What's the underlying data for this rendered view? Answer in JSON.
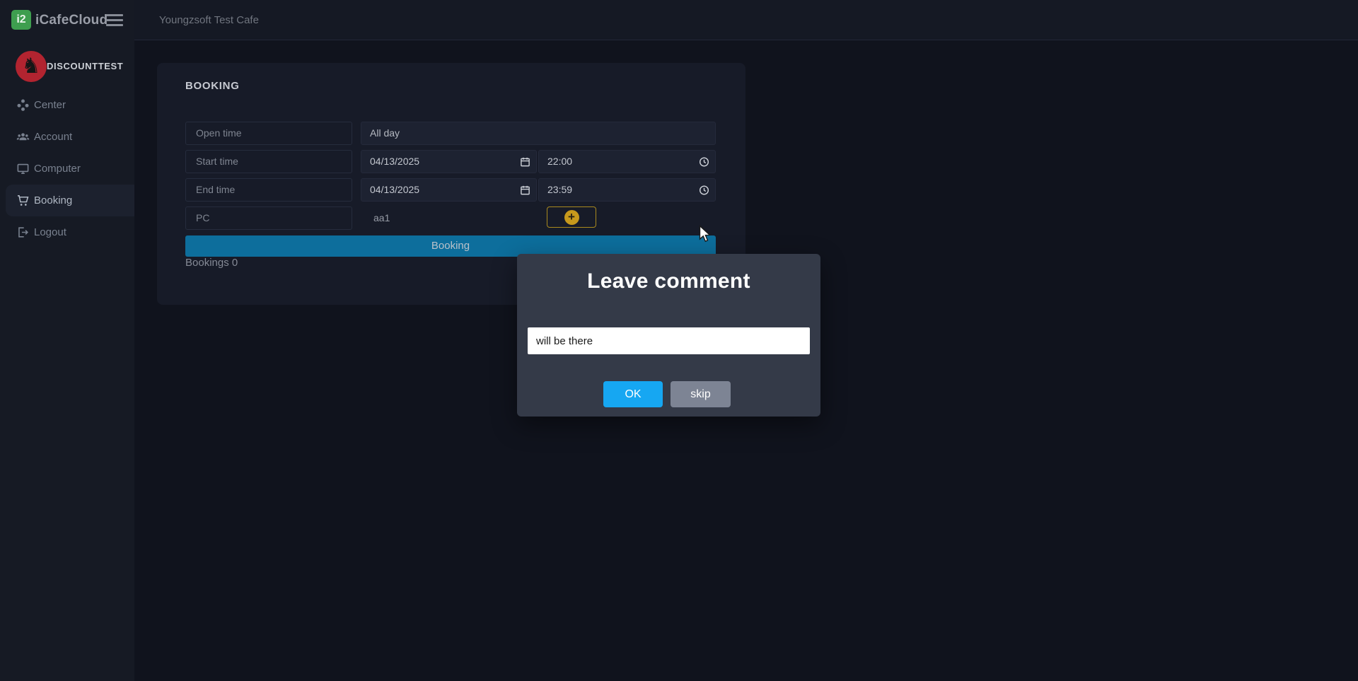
{
  "app": {
    "brand": "iCafeCloud",
    "logo_badge": "i2"
  },
  "topbar": {
    "cafe_name": "Youngzsoft Test Cafe"
  },
  "sidebar": {
    "user": {
      "name": "DISCOUNTTEST",
      "avatar_glyph": "♞"
    },
    "items": [
      {
        "label": "Center",
        "icon": "center-icon",
        "active": false
      },
      {
        "label": "Account",
        "icon": "account-icon",
        "active": false
      },
      {
        "label": "Computer",
        "icon": "computer-icon",
        "active": false
      },
      {
        "label": "Booking",
        "icon": "cart-icon",
        "active": true
      },
      {
        "label": "Logout",
        "icon": "logout-icon",
        "active": false
      }
    ]
  },
  "booking": {
    "title": "BOOKING",
    "open_time": {
      "label": "Open time",
      "value": "All day"
    },
    "start_time": {
      "label": "Start time",
      "date": "04/13/2025",
      "time": "22:00"
    },
    "end_time": {
      "label": "End time",
      "date": "04/13/2025",
      "time": "23:59"
    },
    "pc": {
      "label": "PC",
      "value": "aa1",
      "add_symbol": "+"
    },
    "submit_label": "Booking",
    "bookings_count": "Bookings 0"
  },
  "modal": {
    "title": "Leave comment",
    "comment_value": "will be there",
    "ok_label": "OK",
    "skip_label": "skip"
  },
  "colors": {
    "page_bg": "#10131d",
    "sidebar_bg": "#161a24",
    "topbar_bg": "#151924",
    "card_bg": "#171b28",
    "field_bg": "#1d2231",
    "field_border": "#262c3d",
    "submit_blue": "#0d6e9c",
    "modal_bg": "#343a48",
    "ok_blue": "#16a7f2",
    "skip_gray": "#7d8494",
    "plus_amber": "#c7991c",
    "avatar_red": "#b22430",
    "logo_green": "#3e9e4f"
  }
}
